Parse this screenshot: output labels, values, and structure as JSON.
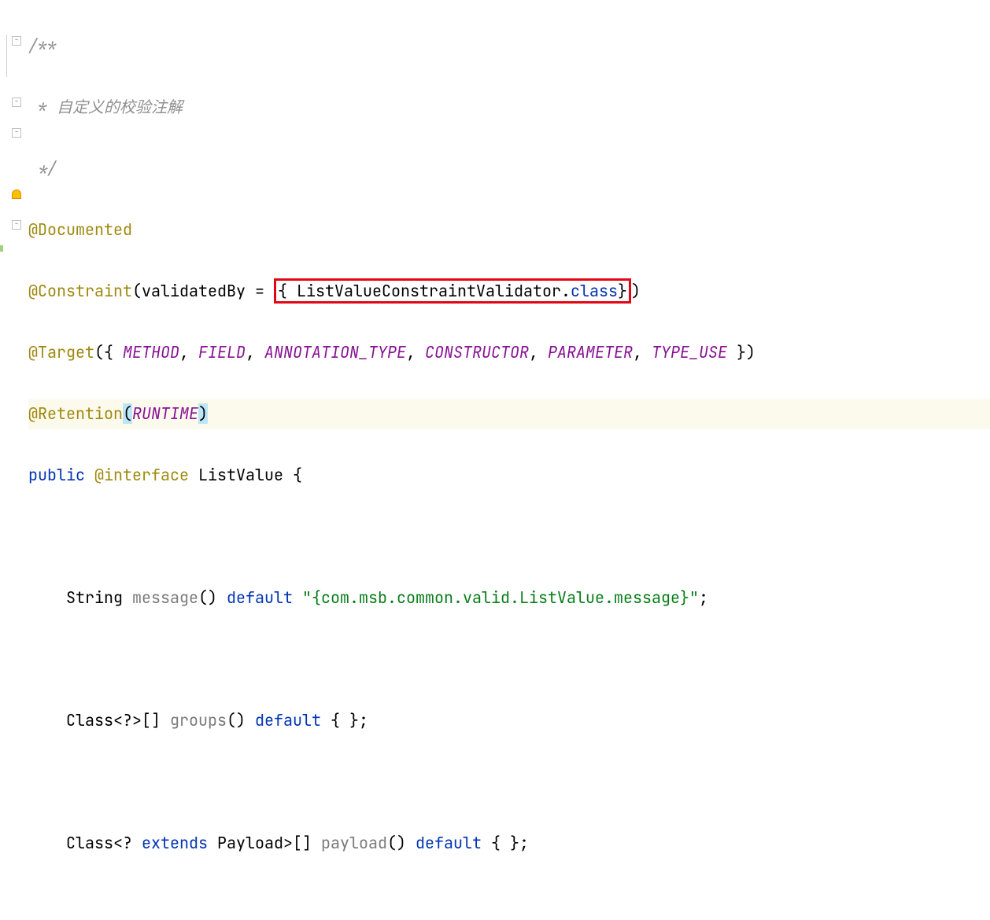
{
  "comment": {
    "open": "/**",
    "body": " * 自定义的校验注解",
    "close": " */"
  },
  "annotations": {
    "documented": "@Documented",
    "constraint_head": "@Constraint",
    "constraint_param_name": "validatedBy = ",
    "constraint_brace_open": "{ ",
    "constraint_validator": "ListValueConstraintValidator",
    "constraint_dot": ".",
    "constraint_class": "class",
    "constraint_brace_close": "}",
    "target_head": "@Target",
    "target_open": "({ ",
    "target_items": {
      "m1": "METHOD",
      "m2": "FIELD",
      "m3": "ANNOTATION_TYPE",
      "m4": "CONSTRUCTOR",
      "m5": "PARAMETER",
      "m6": "TYPE_USE"
    },
    "target_sep": ", ",
    "target_close": " })",
    "retention_head": "@Retention",
    "retention_open": "(",
    "retention_val": "RUNTIME",
    "retention_close": ")"
  },
  "declaration": {
    "public_kw": "public ",
    "at_interface": "@interface",
    "name": " ListValue ",
    "brace": "{"
  },
  "members": {
    "message": {
      "indent": "    ",
      "type": "String ",
      "name": "message",
      "parens": "() ",
      "default_kw": "default ",
      "value": "\"{com.msb.common.valid.ListValue.message}\"",
      "semi": ";"
    },
    "groups": {
      "indent": "    ",
      "type_pre": "Class<?>[] ",
      "name": "groups",
      "parens": "() ",
      "default_kw": "default ",
      "value": "{ }",
      "semi": ";"
    },
    "payload": {
      "indent": "    ",
      "type_pre": "Class<? ",
      "extends_kw": "extends",
      "type_post": " Payload>[] ",
      "name": "payload",
      "parens": "() ",
      "default_kw": "default ",
      "value": "{ }",
      "semi": ";"
    }
  }
}
